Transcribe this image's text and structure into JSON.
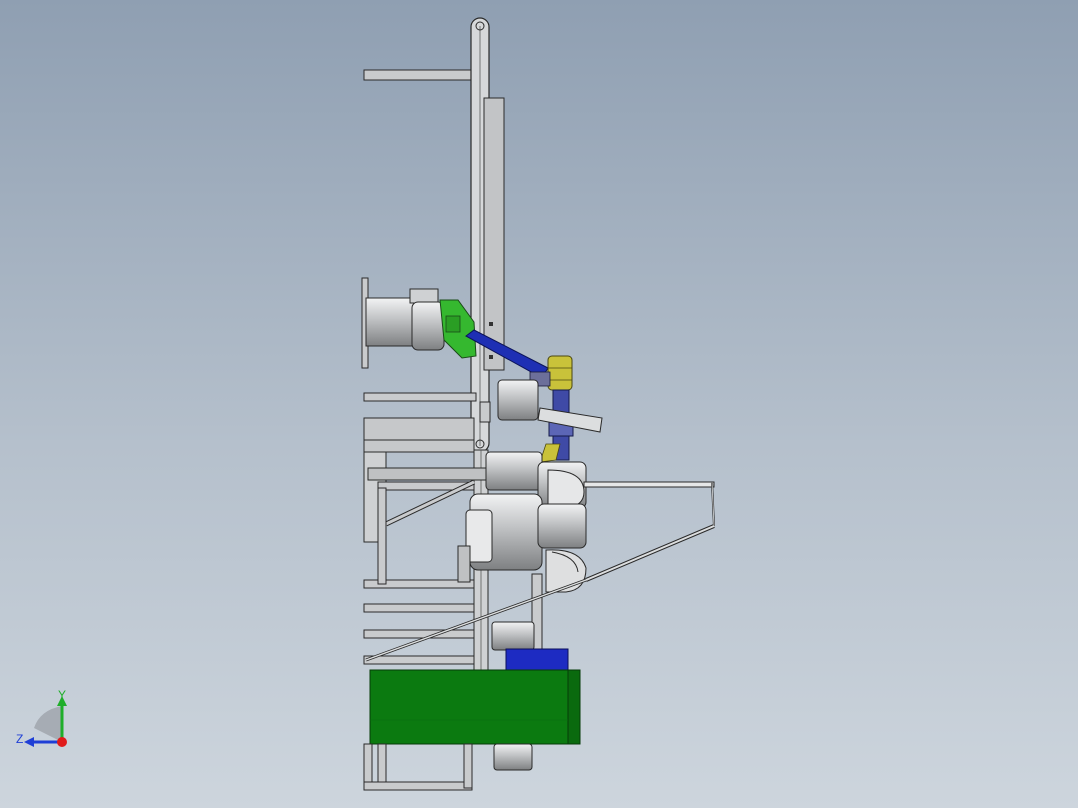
{
  "triad": {
    "y_axis_label": "Y",
    "z_axis_label": "Z",
    "y_axis_color": "#1fae2a",
    "z_axis_color": "#1f3fd6",
    "x_axis_color": "#e01b1b"
  },
  "model_colors": {
    "background_top": "#8f9fb2",
    "background_bottom": "#cdd5dd",
    "steel": "#c4c6c8",
    "steel_dark": "#8c8e90",
    "edge": "#2a2a2a",
    "motor_green": "#0b7a10",
    "gearbox_green": "#35b82f",
    "shaft_blue": "#1e2fb4",
    "coupling_yellow": "#c9c23a",
    "block_blue": "#1d2bc2"
  }
}
